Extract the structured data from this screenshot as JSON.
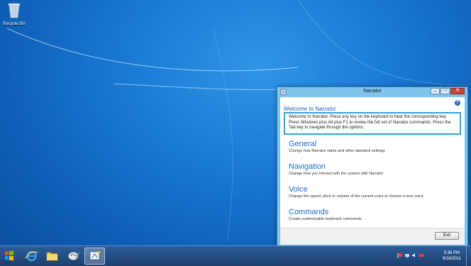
{
  "desktop": {
    "recycle_bin_label": "Recycle Bin"
  },
  "narrator": {
    "window_title": "Narrator",
    "help_label": "?",
    "welcome_heading": "Welcome to Narrator",
    "welcome_text": "Welcome to Narrator. Press any key on the keyboard to hear the corresponding key. Press Windows plus Alt plus F1 to review the full set of Narrator commands. Press the Tab key to navigate through the options.",
    "sections": [
      {
        "title": "General",
        "desc": "Change how Narrator starts and other standard settings"
      },
      {
        "title": "Navigation",
        "desc": "Change how you interact with the system with Narrator"
      },
      {
        "title": "Voice",
        "desc": "Change the speed, pitch or volume of the current voice or choose a new voice"
      },
      {
        "title": "Commands",
        "desc": "Create customizable keyboard commands"
      }
    ],
    "exit_label": "Exit"
  },
  "taskbar": {
    "time": "5:36 PM",
    "date": "9/16/2011"
  },
  "colors": {
    "accent": "#1b6fc9",
    "focus_border": "#35a3dc",
    "desktop": "#1a7bd4"
  }
}
